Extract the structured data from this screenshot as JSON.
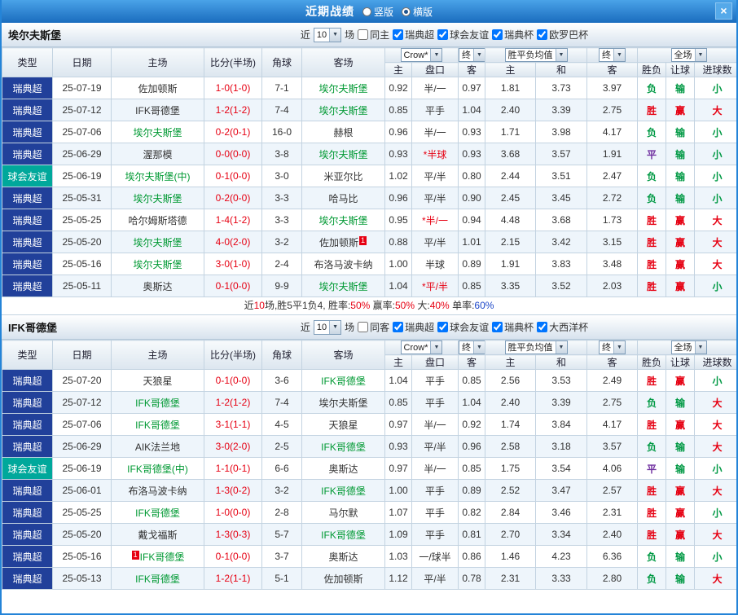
{
  "colors": {
    "win": "#e60012",
    "draw": "#7030a0",
    "lose": "#009944",
    "blue": "#1b46c8",
    "focus_team": "#009933",
    "score": "#e60012",
    "league_super": "#21409a",
    "league_friendly": "#00a89b",
    "star_handicap": "#e60012"
  },
  "topbar": {
    "title": "近期战绩",
    "radios": [
      {
        "label": "竖版",
        "selected": false
      },
      {
        "label": "横版",
        "selected": true
      }
    ],
    "close_label": "×"
  },
  "table_header": {
    "type": "类型",
    "date": "日期",
    "home": "主场",
    "score": "比分(半场)",
    "corner": "角球",
    "away": "客场",
    "odds_source_dd": "Crow*",
    "final_dd": "终",
    "odds_home": "主",
    "odds_handicap": "盘口",
    "odds_away": "客",
    "avg_dd": "胜平负均值",
    "avg_home": "主",
    "avg_draw": "和",
    "avg_away": "客",
    "full_dd": "全场",
    "result": "胜负",
    "handicap_result": "让球",
    "goals": "进球数"
  },
  "sections": [
    {
      "team": "埃尔夫斯堡",
      "filter": {
        "near": "近",
        "count": "10",
        "games": "场",
        "same": {
          "label": "同主",
          "checked": false
        },
        "leagues": [
          {
            "label": "瑞典超",
            "checked": true
          },
          {
            "label": "球会友谊",
            "checked": true
          },
          {
            "label": "瑞典杯",
            "checked": true
          },
          {
            "label": "欧罗巴杯",
            "checked": true
          }
        ]
      },
      "rows": [
        {
          "lg": "瑞典超",
          "date": "25-07-19",
          "home": "佐加顿斯",
          "hf": false,
          "score": "1-0(1-0)",
          "corner": "7-1",
          "away": "埃尔夫斯堡",
          "af": true,
          "o1": "0.92",
          "hc": "半/一",
          "o2": "0.97",
          "m1": "1.81",
          "m2": "3.73",
          "m3": "3.97",
          "r": "负",
          "hr": "输",
          "g": "小"
        },
        {
          "lg": "瑞典超",
          "date": "25-07-12",
          "home": "IFK哥德堡",
          "hf": false,
          "score": "1-2(1-2)",
          "corner": "7-4",
          "away": "埃尔夫斯堡",
          "af": true,
          "o1": "0.85",
          "hc": "平手",
          "o2": "1.04",
          "m1": "2.40",
          "m2": "3.39",
          "m3": "2.75",
          "r": "胜",
          "hr": "赢",
          "g": "大"
        },
        {
          "lg": "瑞典超",
          "date": "25-07-06",
          "home": "埃尔夫斯堡",
          "hf": true,
          "score": "0-2(0-1)",
          "corner": "16-0",
          "away": "赫根",
          "af": false,
          "o1": "0.96",
          "hc": "半/一",
          "o2": "0.93",
          "m1": "1.71",
          "m2": "3.98",
          "m3": "4.17",
          "r": "负",
          "hr": "输",
          "g": "小"
        },
        {
          "lg": "瑞典超",
          "date": "25-06-29",
          "home": "渥那模",
          "hf": false,
          "score": "0-0(0-0)",
          "corner": "3-8",
          "away": "埃尔夫斯堡",
          "af": true,
          "o1": "0.93",
          "hc": "*半球",
          "o2": "0.93",
          "m1": "3.68",
          "m2": "3.57",
          "m3": "1.91",
          "r": "平",
          "hr": "输",
          "g": "小"
        },
        {
          "lg": "球会友谊",
          "date": "25-06-19",
          "home": "埃尔夫斯堡(中)",
          "hf": true,
          "score": "0-1(0-0)",
          "corner": "3-0",
          "away": "米亚尔比",
          "af": false,
          "o1": "1.02",
          "hc": "平/半",
          "o2": "0.80",
          "m1": "2.44",
          "m2": "3.51",
          "m3": "2.47",
          "r": "负",
          "hr": "输",
          "g": "小"
        },
        {
          "lg": "瑞典超",
          "date": "25-05-31",
          "home": "埃尔夫斯堡",
          "hf": true,
          "score": "0-2(0-0)",
          "corner": "3-3",
          "away": "哈马比",
          "af": false,
          "o1": "0.96",
          "hc": "平/半",
          "o2": "0.90",
          "m1": "2.45",
          "m2": "3.45",
          "m3": "2.72",
          "r": "负",
          "hr": "输",
          "g": "小"
        },
        {
          "lg": "瑞典超",
          "date": "25-05-25",
          "home": "哈尔姆斯塔德",
          "hf": false,
          "score": "1-4(1-2)",
          "corner": "3-3",
          "away": "埃尔夫斯堡",
          "af": true,
          "o1": "0.95",
          "hc": "*半/一",
          "o2": "0.94",
          "m1": "4.48",
          "m2": "3.68",
          "m3": "1.73",
          "r": "胜",
          "hr": "赢",
          "g": "大"
        },
        {
          "lg": "瑞典超",
          "date": "25-05-20",
          "home": "埃尔夫斯堡",
          "hf": true,
          "score": "4-0(2-0)",
          "corner": "3-2",
          "away": "佐加顿斯",
          "af": false,
          "asup": "1",
          "o1": "0.88",
          "hc": "平/半",
          "o2": "1.01",
          "m1": "2.15",
          "m2": "3.42",
          "m3": "3.15",
          "r": "胜",
          "hr": "赢",
          "g": "大"
        },
        {
          "lg": "瑞典超",
          "date": "25-05-16",
          "home": "埃尔夫斯堡",
          "hf": true,
          "score": "3-0(1-0)",
          "corner": "2-4",
          "away": "布洛马波卡纳",
          "af": false,
          "o1": "1.00",
          "hc": "半球",
          "o2": "0.89",
          "m1": "1.91",
          "m2": "3.83",
          "m3": "3.48",
          "r": "胜",
          "hr": "赢",
          "g": "大"
        },
        {
          "lg": "瑞典超",
          "date": "25-05-11",
          "home": "奥斯达",
          "hf": false,
          "score": "0-1(0-0)",
          "corner": "9-9",
          "away": "埃尔夫斯堡",
          "af": true,
          "o1": "1.04",
          "hc": "*平/半",
          "o2": "0.85",
          "m1": "3.35",
          "m2": "3.52",
          "m3": "2.03",
          "r": "胜",
          "hr": "赢",
          "g": "小"
        }
      ],
      "summary": [
        {
          "text": "近",
          "color": "#333333"
        },
        {
          "text": "10",
          "color": "#e60012"
        },
        {
          "text": "场,胜5平1负4, 胜率:",
          "color": "#333333"
        },
        {
          "text": "50%",
          "color": "#e60012"
        },
        {
          "text": " 赢率:",
          "color": "#333333"
        },
        {
          "text": "50%",
          "color": "#e60012"
        },
        {
          "text": " 大:",
          "color": "#333333"
        },
        {
          "text": "40%",
          "color": "#e60012"
        },
        {
          "text": " 单率:",
          "color": "#333333"
        },
        {
          "text": "60%",
          "color": "#1b46c8"
        }
      ]
    },
    {
      "team": "IFK哥德堡",
      "filter": {
        "near": "近",
        "count": "10",
        "games": "场",
        "same": {
          "label": "同客",
          "checked": false
        },
        "leagues": [
          {
            "label": "瑞典超",
            "checked": true
          },
          {
            "label": "球会友谊",
            "checked": true
          },
          {
            "label": "瑞典杯",
            "checked": true
          },
          {
            "label": "大西洋杯",
            "checked": true
          }
        ]
      },
      "rows": [
        {
          "lg": "瑞典超",
          "date": "25-07-20",
          "home": "天狼星",
          "hf": false,
          "score": "0-1(0-0)",
          "corner": "3-6",
          "away": "IFK哥德堡",
          "af": true,
          "o1": "1.04",
          "hc": "平手",
          "o2": "0.85",
          "m1": "2.56",
          "m2": "3.53",
          "m3": "2.49",
          "r": "胜",
          "hr": "赢",
          "g": "小"
        },
        {
          "lg": "瑞典超",
          "date": "25-07-12",
          "home": "IFK哥德堡",
          "hf": true,
          "score": "1-2(1-2)",
          "corner": "7-4",
          "away": "埃尔夫斯堡",
          "af": false,
          "o1": "0.85",
          "hc": "平手",
          "o2": "1.04",
          "m1": "2.40",
          "m2": "3.39",
          "m3": "2.75",
          "r": "负",
          "hr": "输",
          "g": "大"
        },
        {
          "lg": "瑞典超",
          "date": "25-07-06",
          "home": "IFK哥德堡",
          "hf": true,
          "score": "3-1(1-1)",
          "corner": "4-5",
          "away": "天狼星",
          "af": false,
          "o1": "0.97",
          "hc": "半/一",
          "o2": "0.92",
          "m1": "1.74",
          "m2": "3.84",
          "m3": "4.17",
          "r": "胜",
          "hr": "赢",
          "g": "大"
        },
        {
          "lg": "瑞典超",
          "date": "25-06-29",
          "home": "AIK法兰地",
          "hf": false,
          "score": "3-0(2-0)",
          "corner": "2-5",
          "away": "IFK哥德堡",
          "af": true,
          "o1": "0.93",
          "hc": "平/半",
          "o2": "0.96",
          "m1": "2.58",
          "m2": "3.18",
          "m3": "3.57",
          "r": "负",
          "hr": "输",
          "g": "大"
        },
        {
          "lg": "球会友谊",
          "date": "25-06-19",
          "home": "IFK哥德堡(中)",
          "hf": true,
          "score": "1-1(0-1)",
          "corner": "6-6",
          "away": "奥斯达",
          "af": false,
          "o1": "0.97",
          "hc": "半/一",
          "o2": "0.85",
          "m1": "1.75",
          "m2": "3.54",
          "m3": "4.06",
          "r": "平",
          "hr": "输",
          "g": "小"
        },
        {
          "lg": "瑞典超",
          "date": "25-06-01",
          "home": "布洛马波卡纳",
          "hf": false,
          "score": "1-3(0-2)",
          "corner": "3-2",
          "away": "IFK哥德堡",
          "af": true,
          "o1": "1.00",
          "hc": "平手",
          "o2": "0.89",
          "m1": "2.52",
          "m2": "3.47",
          "m3": "2.57",
          "r": "胜",
          "hr": "赢",
          "g": "大"
        },
        {
          "lg": "瑞典超",
          "date": "25-05-25",
          "home": "IFK哥德堡",
          "hf": true,
          "score": "1-0(0-0)",
          "corner": "2-8",
          "away": "马尔默",
          "af": false,
          "o1": "1.07",
          "hc": "平手",
          "o2": "0.82",
          "m1": "2.84",
          "m2": "3.46",
          "m3": "2.31",
          "r": "胜",
          "hr": "赢",
          "g": "小"
        },
        {
          "lg": "瑞典超",
          "date": "25-05-20",
          "home": "戴戈福斯",
          "hf": false,
          "score": "1-3(0-3)",
          "corner": "5-7",
          "away": "IFK哥德堡",
          "af": true,
          "o1": "1.09",
          "hc": "平手",
          "o2": "0.81",
          "m1": "2.70",
          "m2": "3.34",
          "m3": "2.40",
          "r": "胜",
          "hr": "赢",
          "g": "大"
        },
        {
          "lg": "瑞典超",
          "date": "25-05-16",
          "home": "IFK哥德堡",
          "hf": true,
          "hsup": "1",
          "score": "0-1(0-0)",
          "corner": "3-7",
          "away": "奥斯达",
          "af": false,
          "o1": "1.03",
          "hc": "一/球半",
          "o2": "0.86",
          "m1": "1.46",
          "m2": "4.23",
          "m3": "6.36",
          "r": "负",
          "hr": "输",
          "g": "小"
        },
        {
          "lg": "瑞典超",
          "date": "25-05-13",
          "home": "IFK哥德堡",
          "hf": true,
          "score": "1-2(1-1)",
          "corner": "5-1",
          "away": "佐加顿斯",
          "af": false,
          "o1": "1.12",
          "hc": "平/半",
          "o2": "0.78",
          "m1": "2.31",
          "m2": "3.33",
          "m3": "2.80",
          "r": "负",
          "hr": "输",
          "g": "大"
        }
      ],
      "summary": null
    }
  ]
}
